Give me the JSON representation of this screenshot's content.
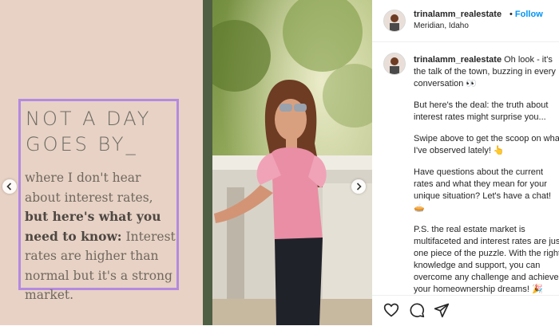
{
  "slide": {
    "headline": "NOT A DAY\nGOES BY_",
    "body_lead": "where I don't hear about interest rates, ",
    "body_bold": "but here's what you need to know:",
    "body_tail": " Interest rates are higher than normal but it's a strong market."
  },
  "post": {
    "username": "trinalamm_realestate",
    "separator": "•",
    "follow_label": "Follow",
    "location": "Meridian, Idaho"
  },
  "caption": {
    "username": "trinalamm_realestate",
    "lines": [
      [
        "Oh look - it's",
        "the talk of the town, buzzing in every",
        "conversation 👀"
      ],
      [
        "But here's the deal: the truth about",
        "interest rates might surprise you..."
      ],
      [
        "Swipe above to get the scoop on what",
        "I've observed lately! 👆"
      ],
      [
        "Have questions about the current",
        "rates and what they mean for your",
        "unique situation? Let's have a chat!",
        "🥧"
      ],
      [
        "P.S. the real estate market is",
        "multifaceted and interest rates are just",
        "one piece of the puzzle. With the right",
        "knowledge and support, you can",
        "overcome any challenge and achieve",
        "your homeownership dreams! 🎉"
      ]
    ]
  },
  "icons": {
    "prev": "chevron-left-icon",
    "next": "chevron-right-icon",
    "like": "heart-icon",
    "comment": "comment-icon",
    "share": "share-icon"
  },
  "colors": {
    "slide_bg": "#e8d2c5",
    "box_border": "#b48ae0",
    "follow": "#0095f6"
  }
}
